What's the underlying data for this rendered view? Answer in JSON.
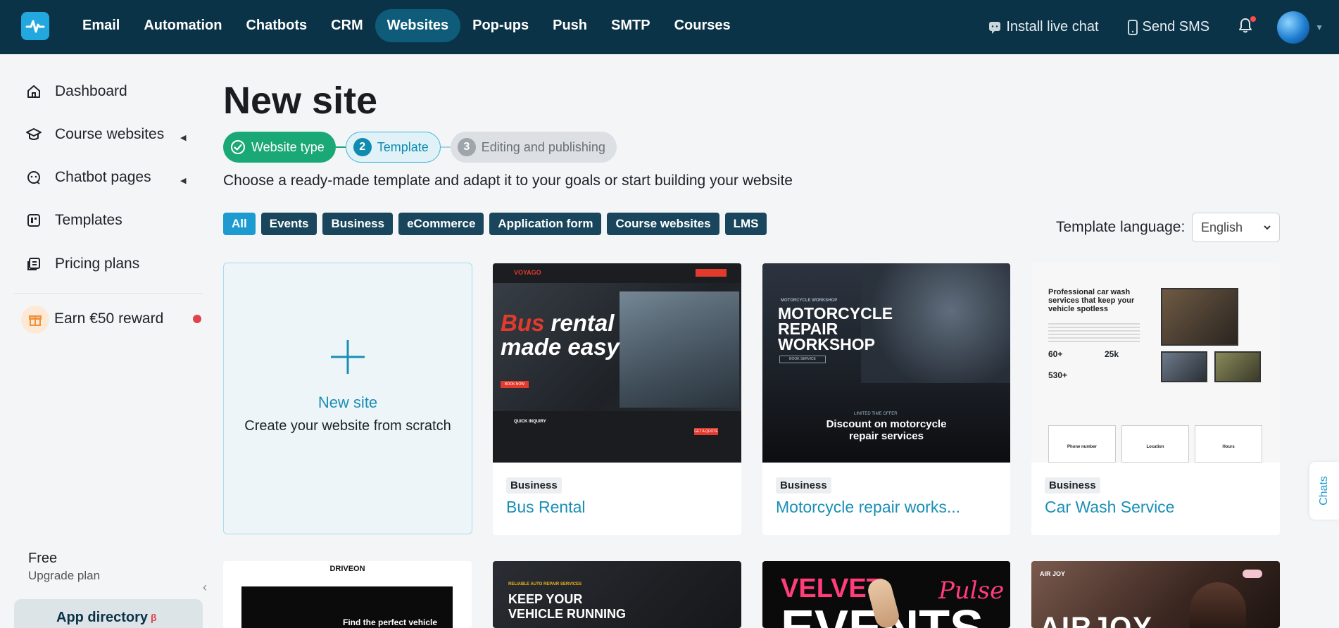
{
  "topnav": {
    "items": [
      "Email",
      "Automation",
      "Chatbots",
      "CRM",
      "Websites",
      "Pop-ups",
      "Push",
      "SMTP",
      "Courses"
    ],
    "active_index": 4,
    "install_live_chat": "Install live chat",
    "send_sms": "Send SMS"
  },
  "sidebar": {
    "items": [
      {
        "label": "Dashboard",
        "icon": "home-icon"
      },
      {
        "label": "Course websites",
        "icon": "graduation-cap-icon"
      },
      {
        "label": "Chatbot pages",
        "icon": "chat-bot-icon"
      },
      {
        "label": "Templates",
        "icon": "template-icon"
      },
      {
        "label": "Pricing plans",
        "icon": "pricing-icon"
      }
    ],
    "reward": "Earn €50 reward",
    "plan_name": "Free",
    "upgrade_label": "Upgrade plan",
    "app_directory": "App directory",
    "app_directory_badge": "β"
  },
  "main": {
    "title": "New site",
    "steps": [
      {
        "number": "",
        "label": "Website type",
        "state": "done"
      },
      {
        "number": "2",
        "label": "Template",
        "state": "current"
      },
      {
        "number": "3",
        "label": "Editing and publishing",
        "state": "future"
      }
    ],
    "subtitle": "Choose a ready-made template and adapt it to your goals or start building your website",
    "filters": [
      "All",
      "Events",
      "Business",
      "eCommerce",
      "Application form",
      "Course websites",
      "LMS"
    ],
    "active_filter": "All",
    "language_label": "Template language:",
    "language_value": "English",
    "new_site": {
      "title": "New site",
      "subtitle": "Create your website from scratch"
    },
    "templates": [
      {
        "tag": "Business",
        "name": "Bus Rental",
        "preview": {
          "brand": "VOYAGO",
          "headline_1": "Bus",
          "headline_2": "rental",
          "headline_3": "made easy",
          "cta": "BOOK NOW",
          "inquiry": "QUICK INQUIRY",
          "submit": "GET A QUOTE"
        }
      },
      {
        "tag": "Business",
        "name": "Motorcycle repair works...",
        "preview": {
          "kicker": "MOTORCYCLE WORKSHOP",
          "headline": "MOTORCYCLE REPAIR WORKSHOP",
          "cta": "BOOK SERVICE",
          "offer_kicker": "LIMITED TIME OFFER",
          "offer": "Discount on motorcycle repair services"
        }
      },
      {
        "tag": "Business",
        "name": "Car Wash Service",
        "preview": {
          "headline": "Professional car wash services that keep your vehicle spotless",
          "stat_1": "60+",
          "stat_2": "25k",
          "stat_3": "530+",
          "card_1": "Phone number",
          "card_2": "Location",
          "card_3": "Hours"
        }
      }
    ],
    "second_row": [
      {
        "brand": "DRIVEON",
        "headline": "Find the perfect vehicle"
      },
      {
        "kicker": "RELIABLE AUTO REPAIR SERVICES",
        "headline": "KEEP YOUR VEHICLE RUNNING"
      },
      {
        "headline_1": "VELVET",
        "headline_2": "EVENTS",
        "script": "Pulse"
      },
      {
        "brand": "AIR JOY",
        "headline": "AIRJOY"
      }
    ]
  },
  "chats_tab": "Chats",
  "colors": {
    "nav_bg": "#0b3348",
    "accent": "#1d9bd1",
    "done": "#1aa876",
    "chip": "#19465c"
  }
}
